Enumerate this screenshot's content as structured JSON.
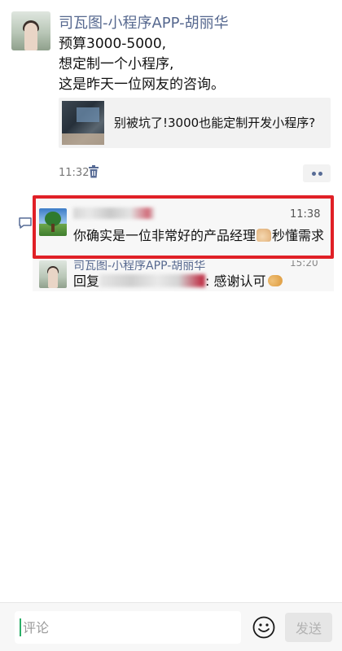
{
  "post": {
    "author": "司瓦图-小程序APP-胡丽华",
    "content_lines": [
      "预算3000-5000,",
      "想定制一个小程序,",
      "这是昨天一位网友的咨询。"
    ],
    "link_title": "别被坑了!3000也能定制开发小程序?",
    "time": "11:32",
    "icons": [
      "trash-icon",
      "more-icon"
    ]
  },
  "comments": [
    {
      "author": "",
      "time": "11:38",
      "text_before": "你确实是一位非常好的产品经理",
      "text_after": "秒懂需求",
      "highlighted": true
    },
    {
      "author": "司瓦图-小程序APP-胡丽华",
      "time": "15:20",
      "reply_prefix": "回复",
      "reply_text": ": 感谢认可"
    }
  ],
  "input": {
    "placeholder": "评论",
    "send_label": "发送"
  },
  "colors": {
    "name_link": "#56688f",
    "highlight_border": "#e02026",
    "caret": "#2aae67",
    "send_disabled_bg": "#e6e6e6"
  }
}
